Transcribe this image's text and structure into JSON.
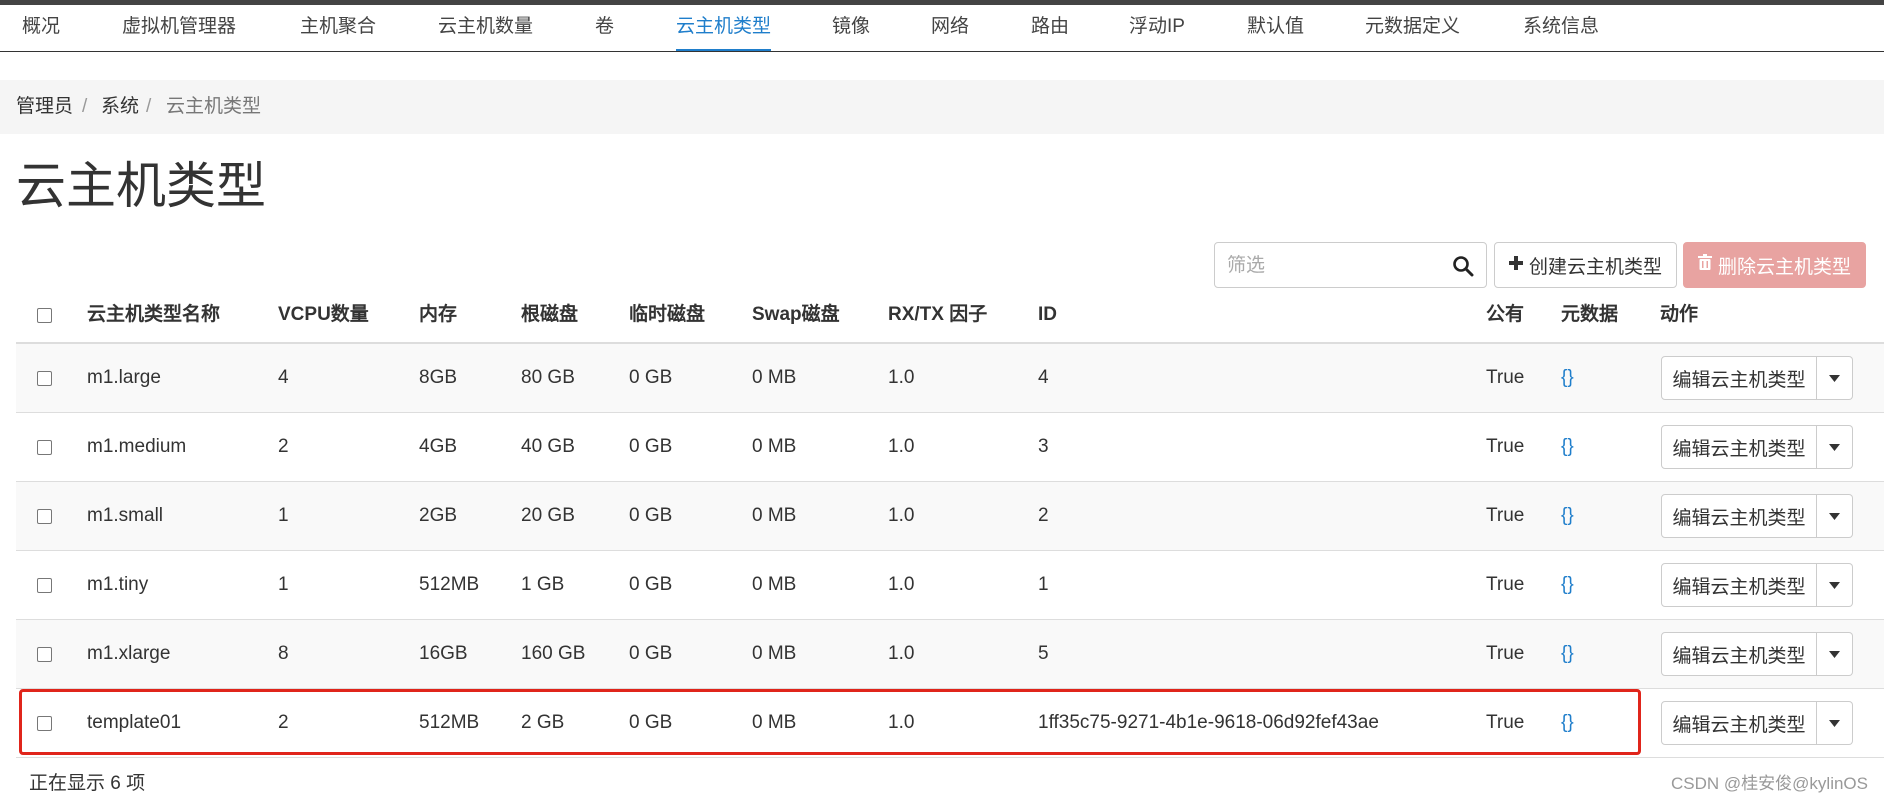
{
  "nav": {
    "tabs": [
      {
        "label": "概况"
      },
      {
        "label": "虚拟机管理器"
      },
      {
        "label": "主机聚合"
      },
      {
        "label": "云主机数量"
      },
      {
        "label": "卷"
      },
      {
        "label": "云主机类型",
        "active": true
      },
      {
        "label": "镜像"
      },
      {
        "label": "网络"
      },
      {
        "label": "路由"
      },
      {
        "label": "浮动IP"
      },
      {
        "label": "默认值"
      },
      {
        "label": "元数据定义"
      },
      {
        "label": "系统信息"
      }
    ]
  },
  "breadcrumb": {
    "items": [
      "管理员",
      "系统",
      "云主机类型"
    ],
    "separator": "/"
  },
  "page": {
    "title": "云主机类型"
  },
  "toolbar": {
    "filter_placeholder": "筛选",
    "filter_value": "",
    "create_label": "创建云主机类型",
    "delete_label": "删除云主机类型"
  },
  "table": {
    "headers": {
      "name": "云主机类型名称",
      "vcpus": "VCPU数量",
      "ram": "内存",
      "root_disk": "根磁盘",
      "ephemeral": "临时磁盘",
      "swap": "Swap磁盘",
      "rxtx": "RX/TX 因子",
      "id": "ID",
      "public": "公有",
      "metadata": "元数据",
      "actions": "动作"
    },
    "rows": [
      {
        "name": "m1.large",
        "vcpus": "4",
        "ram": "8GB",
        "root_disk": "80 GB",
        "ephemeral": "0 GB",
        "swap": "0 MB",
        "rxtx": "1.0",
        "id": "4",
        "public": "True",
        "metadata": "{}",
        "action": "编辑云主机类型"
      },
      {
        "name": "m1.medium",
        "vcpus": "2",
        "ram": "4GB",
        "root_disk": "40 GB",
        "ephemeral": "0 GB",
        "swap": "0 MB",
        "rxtx": "1.0",
        "id": "3",
        "public": "True",
        "metadata": "{}",
        "action": "编辑云主机类型"
      },
      {
        "name": "m1.small",
        "vcpus": "1",
        "ram": "2GB",
        "root_disk": "20 GB",
        "ephemeral": "0 GB",
        "swap": "0 MB",
        "rxtx": "1.0",
        "id": "2",
        "public": "True",
        "metadata": "{}",
        "action": "编辑云主机类型"
      },
      {
        "name": "m1.tiny",
        "vcpus": "1",
        "ram": "512MB",
        "root_disk": "1 GB",
        "ephemeral": "0 GB",
        "swap": "0 MB",
        "rxtx": "1.0",
        "id": "1",
        "public": "True",
        "metadata": "{}",
        "action": "编辑云主机类型"
      },
      {
        "name": "m1.xlarge",
        "vcpus": "8",
        "ram": "16GB",
        "root_disk": "160 GB",
        "ephemeral": "0 GB",
        "swap": "0 MB",
        "rxtx": "1.0",
        "id": "5",
        "public": "True",
        "metadata": "{}",
        "action": "编辑云主机类型"
      },
      {
        "name": "template01",
        "vcpus": "2",
        "ram": "512MB",
        "root_disk": "2 GB",
        "ephemeral": "0 GB",
        "swap": "0 MB",
        "rxtx": "1.0",
        "id": "1ff35c75-9271-4b1e-9618-06d92fef43ae",
        "public": "True",
        "metadata": "{}",
        "action": "编辑云主机类型",
        "highlighted": true
      }
    ],
    "footer_count": "正在显示 6 项"
  },
  "watermark": "CSDN @桂安俊@kylinOS",
  "colors": {
    "accent": "#1f7ecb",
    "danger_button": "#e8a3a1",
    "highlight_border": "#e0251b"
  },
  "icons": {
    "search": "search-icon",
    "create": "plus-icon",
    "delete": "trash-icon",
    "dropdown": "caret-down-icon"
  }
}
